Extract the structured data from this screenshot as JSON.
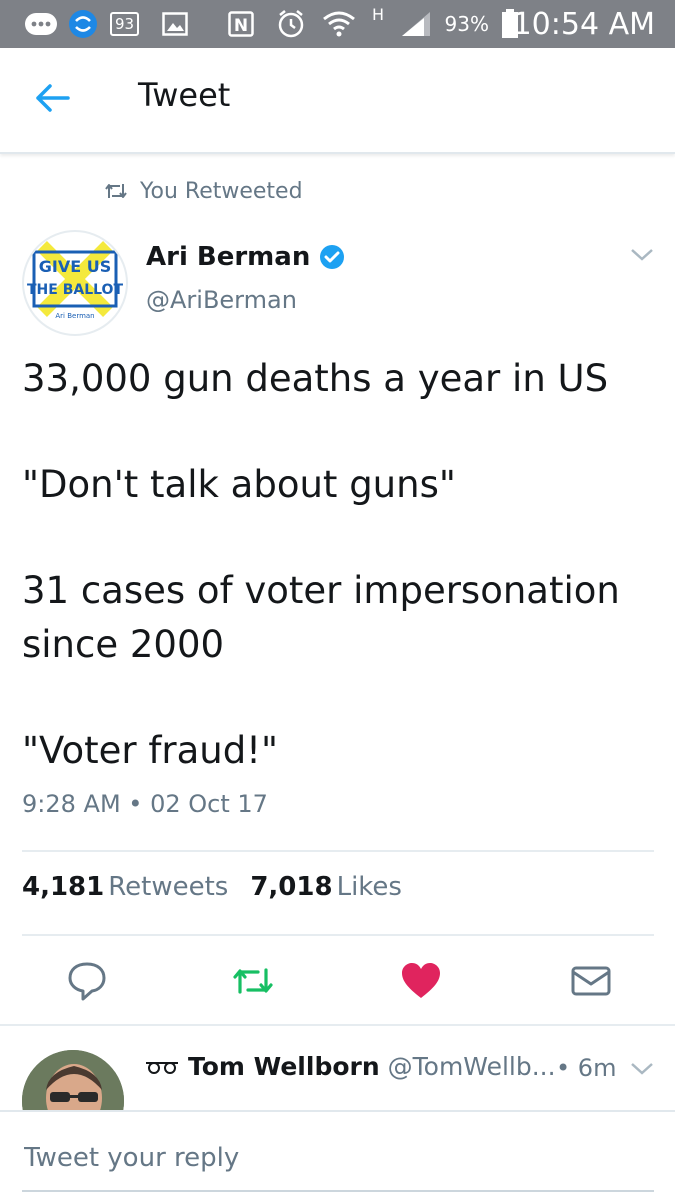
{
  "status_bar": {
    "time": "10:54 AM",
    "battery_percent": "93%",
    "notification_count": "93",
    "network_letter": "H",
    "icons": [
      "messages-icon",
      "sync-icon",
      "notification-93-icon",
      "gallery-icon",
      "nfc-icon",
      "alarm-icon",
      "wifi-icon",
      "signal-icon",
      "battery-icon"
    ]
  },
  "header": {
    "title": "Tweet",
    "back_icon": "back-arrow-icon"
  },
  "retweet_context": {
    "label": "You Retweeted",
    "icon": "retweet-icon"
  },
  "tweet": {
    "author_name": "Ari Berman",
    "verified": true,
    "handle": "@AriBerman",
    "avatar_text": {
      "line1": "GIVE US",
      "line2": "THE BALLOT",
      "line3": "Ari Berman"
    },
    "text_paragraphs": [
      "33,000 gun deaths a year in US",
      "\"Don't talk about guns\"",
      "31 cases of voter impersonation since 2000",
      "\"Voter fraud!\""
    ],
    "timestamp": "9:28 AM • 02 Oct 17",
    "retweets_count": "4,181",
    "retweets_label": "Retweets",
    "likes_count": "7,018",
    "likes_label": "Likes"
  },
  "actions": {
    "reply_icon": "reply-icon",
    "retweet_icon": "retweet-icon",
    "like_icon": "heart-icon",
    "dm_icon": "envelope-icon",
    "colors": {
      "retweet": "#17bf63",
      "like": "#e0245e",
      "neutral": "#657786",
      "accent": "#1da1f2"
    }
  },
  "reply": {
    "name": "Tom Wellborn",
    "handle": "@TomWellb...",
    "time": "6m",
    "name_prefix_icon": "sunglasses-icon"
  },
  "compose": {
    "placeholder": "Tweet your reply"
  }
}
